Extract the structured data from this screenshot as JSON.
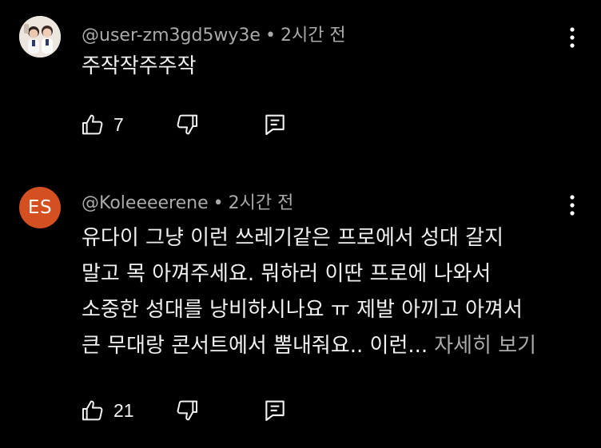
{
  "comments": [
    {
      "handle": "@user-zm3gd5wy3e",
      "separator": "•",
      "time": "2시간 전",
      "avatar": {
        "type": "photo"
      },
      "text_lines": [
        "주작작주주작"
      ],
      "read_more": "",
      "likes": "7"
    },
    {
      "handle": "@Koleeeerene",
      "separator": "•",
      "time": "2시간 전",
      "avatar": {
        "type": "letters",
        "letters": "ES",
        "color": "#d45020"
      },
      "text_lines": [
        "유다이 그냥 이런 쓰레기같은 프로에서 성대 갈지",
        "말고 목 아껴주세요. 뭐하러 이딴 프로에 나와서",
        "소중한 성대를 낭비하시나요 ㅠ 제발 아끼고 아껴서",
        "큰 무대랑 콘서트에서 뽐내줘요.. 이런..."
      ],
      "read_more": "자세히 보기",
      "likes": "21"
    }
  ],
  "icons": {
    "like": "thumbs-up-icon",
    "dislike": "thumbs-down-icon",
    "reply": "reply-icon",
    "menu": "more-vert-icon"
  },
  "colors": {
    "background": "#000000",
    "primary_text": "#f1f1f1",
    "secondary_text": "#aaaaaa",
    "avatar_es": "#d45020"
  }
}
